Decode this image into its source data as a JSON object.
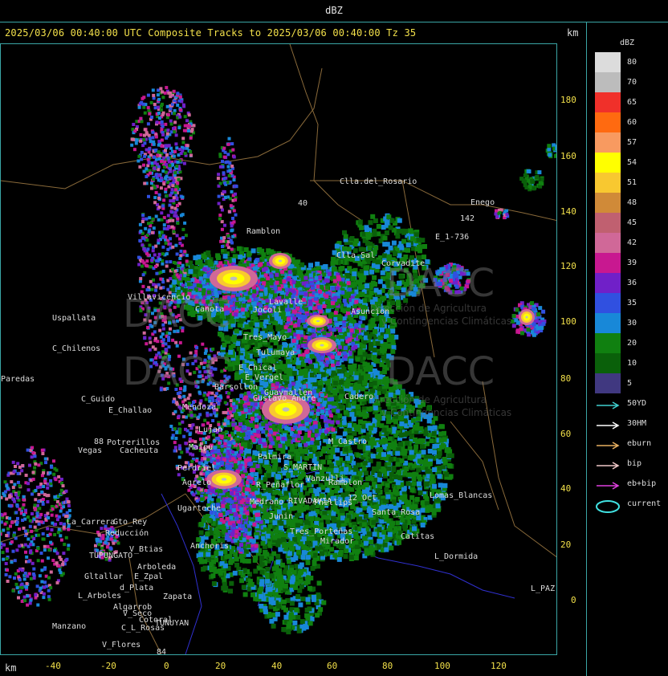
{
  "header": {
    "title": "dBZ"
  },
  "plot": {
    "title": "2025/03/06 00:40:00 UTC Composite Tracks to 2025/03/06 00:40:00 Tz 35",
    "km_label": "km",
    "y_ticks": [
      "180",
      "160",
      "140",
      "120",
      "100",
      "80",
      "60",
      "40",
      "20",
      "0"
    ],
    "x_ticks": [
      "-40",
      "-20",
      "0",
      "20",
      "40",
      "60",
      "80",
      "100",
      "120"
    ]
  },
  "legend": {
    "title": "dBZ",
    "levels": [
      {
        "label": "80",
        "color": "#dcdcdc"
      },
      {
        "label": "70",
        "color": "#bcbcbc"
      },
      {
        "label": "65",
        "color": "#f0302a"
      },
      {
        "label": "60",
        "color": "#ff6a10"
      },
      {
        "label": "57",
        "color": "#f89a60"
      },
      {
        "label": "54",
        "color": "#ffff00"
      },
      {
        "label": "51",
        "color": "#f8c830"
      },
      {
        "label": "48",
        "color": "#d08a38"
      },
      {
        "label": "45",
        "color": "#c06070"
      },
      {
        "label": "42",
        "color": "#d06898"
      },
      {
        "label": "39",
        "color": "#c81890"
      },
      {
        "label": "36",
        "color": "#7020c8"
      },
      {
        "label": "35",
        "color": "#3050e0"
      },
      {
        "label": "30",
        "color": "#1888d8"
      },
      {
        "label": "20",
        "color": "#108010"
      },
      {
        "label": "10",
        "color": "#0a600a"
      },
      {
        "label": "5",
        "color": "#403880"
      }
    ],
    "tracks": [
      {
        "label": "50YD",
        "color": "#40d0d0"
      },
      {
        "label": "30HM",
        "color": "#ffffff"
      },
      {
        "label": "eburn",
        "color": "#e8b060"
      },
      {
        "label": "bip",
        "color": "#f0c8c8"
      },
      {
        "label": "eb+bip",
        "color": "#e040e0"
      },
      {
        "label": "current",
        "color": "#40e0e0"
      }
    ]
  },
  "watermark": {
    "text": "DACC",
    "line1": "Dirección de Agricultura",
    "line2": "y Contingencias Climáticas"
  },
  "places": [
    {
      "name": "Clla.del_Rosario"
    },
    {
      "name": "Ramblon"
    },
    {
      "name": "Enego"
    },
    {
      "name": "142"
    },
    {
      "name": "E_1-736"
    },
    {
      "name": "Clla.Sal"
    },
    {
      "name": "Corvadite"
    },
    {
      "name": "Villavicencio"
    },
    {
      "name": "Uspallata"
    },
    {
      "name": "Canota"
    },
    {
      "name": "Jocoli"
    },
    {
      "name": "Lavalle"
    },
    {
      "name": "Asuncion"
    },
    {
      "name": "C_Chilenos"
    },
    {
      "name": "Tres_Mayo"
    },
    {
      "name": "Tulumaya"
    },
    {
      "name": "E_Chical"
    },
    {
      "name": "E_Vergel"
    },
    {
      "name": "Paredas"
    },
    {
      "name": "Barsollon"
    },
    {
      "name": "Guaymallen"
    },
    {
      "name": "Gustavo_Andre"
    },
    {
      "name": "Cadero"
    },
    {
      "name": "C_Guido"
    },
    {
      "name": "E_Challao"
    },
    {
      "name": "Mendoza"
    },
    {
      "name": "Lujan"
    },
    {
      "name": "Maipu"
    },
    {
      "name": "Potrerillos"
    },
    {
      "name": "Vegas"
    },
    {
      "name": "Cacheuta"
    },
    {
      "name": "Palmira"
    },
    {
      "name": "M_Castro"
    },
    {
      "name": "Perdriel"
    },
    {
      "name": "S_MARTIN"
    },
    {
      "name": "Agrelo"
    },
    {
      "name": "Vanzulli"
    },
    {
      "name": "Ramblon"
    },
    {
      "name": "R_Peñaflor"
    },
    {
      "name": "Lomas_Blancas"
    },
    {
      "name": "Ugarteche"
    },
    {
      "name": "Medrano"
    },
    {
      "name": "RIVADAVIA"
    },
    {
      "name": "Phillips"
    },
    {
      "name": "12_Oct"
    },
    {
      "name": "La_Carrera"
    },
    {
      "name": "Gto_Rey"
    },
    {
      "name": "Reducción"
    },
    {
      "name": "Junin"
    },
    {
      "name": "Santa_Rosa"
    },
    {
      "name": "Catitas"
    },
    {
      "name": "Anchoris"
    },
    {
      "name": "Tres_Porteñas"
    },
    {
      "name": "Mirador"
    },
    {
      "name": "V_Btias"
    },
    {
      "name": "TUPUNGATO"
    },
    {
      "name": "Arboleda"
    },
    {
      "name": "L_Dormida"
    },
    {
      "name": "Gltallar"
    },
    {
      "name": "E_Zpal"
    },
    {
      "name": "d_Plata"
    },
    {
      "name": "L_Arboles"
    },
    {
      "name": "Zapata"
    },
    {
      "name": "Algarrob"
    },
    {
      "name": "V_Seco"
    },
    {
      "name": "Cotoral"
    },
    {
      "name": "TUNUYAN"
    },
    {
      "name": "Manzano"
    },
    {
      "name": "C_L_Rosas"
    },
    {
      "name": "V_Flores"
    },
    {
      "name": "L_PAZ"
    },
    {
      "name": "40"
    },
    {
      "name": "84"
    },
    {
      "name": "88"
    }
  ]
}
